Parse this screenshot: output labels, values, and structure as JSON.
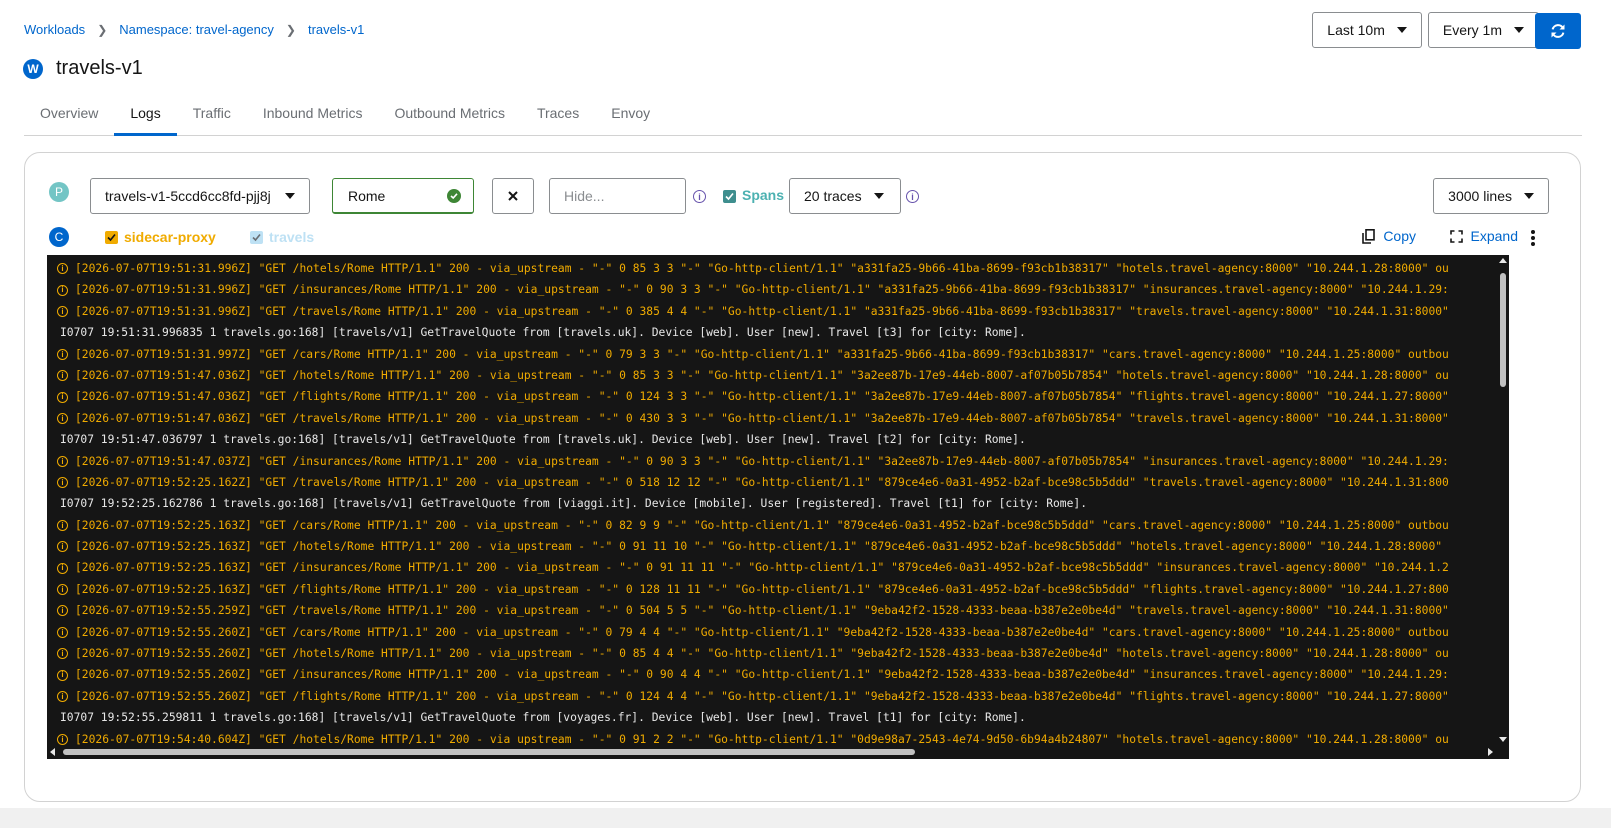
{
  "breadcrumb": {
    "workloads": "Workloads",
    "namespace": "Namespace: travel-agency",
    "current": "travels-v1"
  },
  "title": {
    "badge": "W",
    "name": "travels-v1"
  },
  "controls": {
    "range": "Last 10m",
    "refresh_interval": "Every 1m",
    "refresh_icon": "refresh-icon"
  },
  "tabs": [
    "Overview",
    "Logs",
    "Traffic",
    "Inbound Metrics",
    "Outbound Metrics",
    "Traces",
    "Envoy"
  ],
  "active_tab": "Logs",
  "colors": {
    "accent": "#0066cc",
    "success": "#3e8635",
    "proxy": "#f0ab00",
    "app": "#73bcf7",
    "pod_badge": "#73c5c5",
    "info": "#6753ac"
  },
  "pod": {
    "badge": "P",
    "selected": "travels-v1-5ccd6cc8fd-pjj8j"
  },
  "filter": {
    "show_value": "Rome",
    "hide_placeholder": "Hide..."
  },
  "spans": {
    "label": "Spans",
    "traces": "20 traces"
  },
  "lines": "3000 lines",
  "containers": {
    "badge": "C",
    "proxy": "sidecar-proxy",
    "app": "travels"
  },
  "actions": {
    "copy": "Copy",
    "expand": "Expand"
  },
  "logs": [
    {
      "kind": "proxy",
      "text": "[2026-07-07T19:51:31.996Z] \"GET /hotels/Rome HTTP/1.1\" 200 - via_upstream - \"-\" 0 85 3 3 \"-\" \"Go-http-client/1.1\" \"a331fa25-9b66-41ba-8699-f93cb1b38317\" \"hotels.travel-agency:8000\" \"10.244.1.28:8000\" ou"
    },
    {
      "kind": "proxy",
      "text": "[2026-07-07T19:51:31.996Z] \"GET /insurances/Rome HTTP/1.1\" 200 - via_upstream - \"-\" 0 90 3 3 \"-\" \"Go-http-client/1.1\" \"a331fa25-9b66-41ba-8699-f93cb1b38317\" \"insurances.travel-agency:8000\" \"10.244.1.29:"
    },
    {
      "kind": "proxy",
      "text": "[2026-07-07T19:51:31.996Z] \"GET /travels/Rome HTTP/1.1\" 200 - via_upstream - \"-\" 0 385 4 4 \"-\" \"Go-http-client/1.1\" \"a331fa25-9b66-41ba-8699-f93cb1b38317\" \"travels.travel-agency:8000\" \"10.244.1.31:8000\""
    },
    {
      "kind": "app",
      "text": "I0707 19:51:31.996835       1 travels.go:168] [travels/v1] GetTravelQuote from [travels.uk]. Device [web]. User [new]. Travel [t3] for [city: Rome]."
    },
    {
      "kind": "proxy",
      "text": "[2026-07-07T19:51:31.997Z] \"GET /cars/Rome HTTP/1.1\" 200 - via_upstream - \"-\" 0 79 3 3 \"-\" \"Go-http-client/1.1\" \"a331fa25-9b66-41ba-8699-f93cb1b38317\" \"cars.travel-agency:8000\" \"10.244.1.25:8000\" outbou"
    },
    {
      "kind": "proxy",
      "text": "[2026-07-07T19:51:47.036Z] \"GET /hotels/Rome HTTP/1.1\" 200 - via_upstream - \"-\" 0 85 3 3 \"-\" \"Go-http-client/1.1\" \"3a2ee87b-17e9-44eb-8007-af07b05b7854\" \"hotels.travel-agency:8000\" \"10.244.1.28:8000\" ou"
    },
    {
      "kind": "proxy",
      "text": "[2026-07-07T19:51:47.036Z] \"GET /flights/Rome HTTP/1.1\" 200 - via_upstream - \"-\" 0 124 3 3 \"-\" \"Go-http-client/1.1\" \"3a2ee87b-17e9-44eb-8007-af07b05b7854\" \"flights.travel-agency:8000\" \"10.244.1.27:8000\""
    },
    {
      "kind": "proxy",
      "text": "[2026-07-07T19:51:47.036Z] \"GET /travels/Rome HTTP/1.1\" 200 - via_upstream - \"-\" 0 430 3 3 \"-\" \"Go-http-client/1.1\" \"3a2ee87b-17e9-44eb-8007-af07b05b7854\" \"travels.travel-agency:8000\" \"10.244.1.31:8000\""
    },
    {
      "kind": "app",
      "text": "I0707 19:51:47.036797       1 travels.go:168] [travels/v1] GetTravelQuote from [travels.uk]. Device [web]. User [new]. Travel [t2] for [city: Rome]."
    },
    {
      "kind": "proxy",
      "text": "[2026-07-07T19:51:47.037Z] \"GET /insurances/Rome HTTP/1.1\" 200 - via_upstream - \"-\" 0 90 3 3 \"-\" \"Go-http-client/1.1\" \"3a2ee87b-17e9-44eb-8007-af07b05b7854\" \"insurances.travel-agency:8000\" \"10.244.1.29:"
    },
    {
      "kind": "proxy",
      "text": "[2026-07-07T19:52:25.162Z] \"GET /travels/Rome HTTP/1.1\" 200 - via_upstream - \"-\" 0 518 12 12 \"-\" \"Go-http-client/1.1\" \"879ce4e6-0a31-4952-b2af-bce98c5b5ddd\" \"travels.travel-agency:8000\" \"10.244.1.31:800"
    },
    {
      "kind": "app",
      "text": "I0707 19:52:25.162786       1 travels.go:168] [travels/v1] GetTravelQuote from [viaggi.it]. Device [mobile]. User [registered]. Travel [t1] for [city: Rome]."
    },
    {
      "kind": "proxy",
      "text": "[2026-07-07T19:52:25.163Z] \"GET /cars/Rome HTTP/1.1\" 200 - via_upstream - \"-\" 0 82 9 9 \"-\" \"Go-http-client/1.1\" \"879ce4e6-0a31-4952-b2af-bce98c5b5ddd\" \"cars.travel-agency:8000\" \"10.244.1.25:8000\" outbou"
    },
    {
      "kind": "proxy",
      "text": "[2026-07-07T19:52:25.163Z] \"GET /hotels/Rome HTTP/1.1\" 200 - via_upstream - \"-\" 0 91 11 10 \"-\" \"Go-http-client/1.1\" \"879ce4e6-0a31-4952-b2af-bce98c5b5ddd\" \"hotels.travel-agency:8000\" \"10.244.1.28:8000\""
    },
    {
      "kind": "proxy",
      "text": "[2026-07-07T19:52:25.163Z] \"GET /insurances/Rome HTTP/1.1\" 200 - via_upstream - \"-\" 0 91 11 11 \"-\" \"Go-http-client/1.1\" \"879ce4e6-0a31-4952-b2af-bce98c5b5ddd\" \"insurances.travel-agency:8000\" \"10.244.1.2"
    },
    {
      "kind": "proxy",
      "text": "[2026-07-07T19:52:25.163Z] \"GET /flights/Rome HTTP/1.1\" 200 - via_upstream - \"-\" 0 128 11 11 \"-\" \"Go-http-client/1.1\" \"879ce4e6-0a31-4952-b2af-bce98c5b5ddd\" \"flights.travel-agency:8000\" \"10.244.1.27:800"
    },
    {
      "kind": "proxy",
      "text": "[2026-07-07T19:52:55.259Z] \"GET /travels/Rome HTTP/1.1\" 200 - via_upstream - \"-\" 0 504 5 5 \"-\" \"Go-http-client/1.1\" \"9eba42f2-1528-4333-beaa-b387e2e0be4d\" \"travels.travel-agency:8000\" \"10.244.1.31:8000\""
    },
    {
      "kind": "proxy",
      "text": "[2026-07-07T19:52:55.260Z] \"GET /cars/Rome HTTP/1.1\" 200 - via_upstream - \"-\" 0 79 4 4 \"-\" \"Go-http-client/1.1\" \"9eba42f2-1528-4333-beaa-b387e2e0be4d\" \"cars.travel-agency:8000\" \"10.244.1.25:8000\" outbou"
    },
    {
      "kind": "proxy",
      "text": "[2026-07-07T19:52:55.260Z] \"GET /hotels/Rome HTTP/1.1\" 200 - via_upstream - \"-\" 0 85 4 4 \"-\" \"Go-http-client/1.1\" \"9eba42f2-1528-4333-beaa-b387e2e0be4d\" \"hotels.travel-agency:8000\" \"10.244.1.28:8000\" ou"
    },
    {
      "kind": "proxy",
      "text": "[2026-07-07T19:52:55.260Z] \"GET /insurances/Rome HTTP/1.1\" 200 - via_upstream - \"-\" 0 90 4 4 \"-\" \"Go-http-client/1.1\" \"9eba42f2-1528-4333-beaa-b387e2e0be4d\" \"insurances.travel-agency:8000\" \"10.244.1.29:"
    },
    {
      "kind": "proxy",
      "text": "[2026-07-07T19:52:55.260Z] \"GET /flights/Rome HTTP/1.1\" 200 - via_upstream - \"-\" 0 124 4 4 \"-\" \"Go-http-client/1.1\" \"9eba42f2-1528-4333-beaa-b387e2e0be4d\" \"flights.travel-agency:8000\" \"10.244.1.27:8000\""
    },
    {
      "kind": "app",
      "text": "I0707 19:52:55.259811       1 travels.go:168] [travels/v1] GetTravelQuote from [voyages.fr]. Device [web]. User [new]. Travel [t1] for [city: Rome]."
    },
    {
      "kind": "proxy",
      "text": "[2026-07-07T19:54:40.604Z] \"GET /hotels/Rome HTTP/1.1\" 200 - via_upstream - \"-\" 0 91 2 2 \"-\" \"Go-http-client/1.1\" \"0d9e98a7-2543-4e74-9d50-6b94a4b24807\" \"hotels.travel-agency:8000\" \"10.244.1.28:8000\" ou"
    }
  ]
}
